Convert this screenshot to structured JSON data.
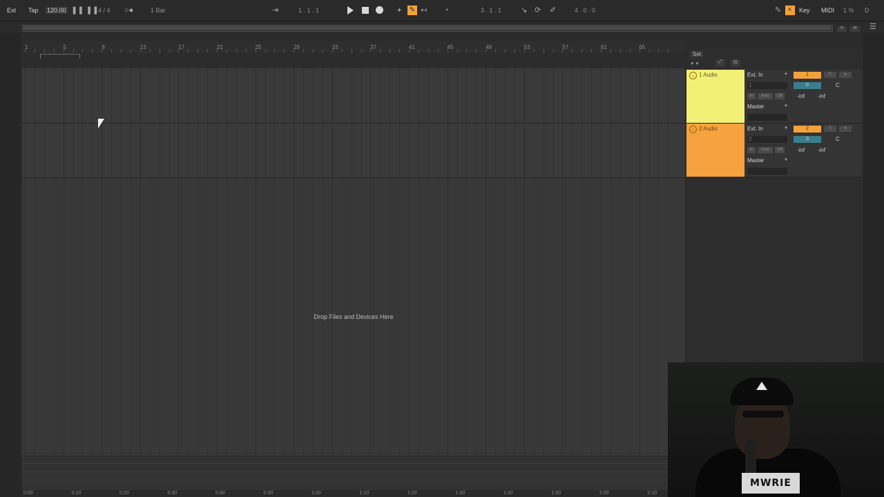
{
  "topbar": {
    "ext_label": "Ext",
    "tap_label": "Tap",
    "tempo": "120.00",
    "signature": "4 / 4",
    "quantize": "1 Bar",
    "position": "1 . 1 . 1",
    "loop_position": "3 . 1 . 1",
    "loop_length": "4 . 0 . 0",
    "key_label": "Key",
    "midi_label": "MIDI",
    "cpu": "1 %",
    "disk": "D",
    "icons": [
      "follow-icon",
      "play-icon",
      "stop-icon",
      "record-icon",
      "add-icon",
      "draw-mode-icon",
      "loop-icon",
      "pencil-icon",
      "key-icon",
      "menu-icon"
    ]
  },
  "ruler": {
    "bars": [
      "1",
      "5",
      "9",
      "13",
      "17",
      "21",
      "25",
      "29",
      "33",
      "37",
      "41",
      "45",
      "49",
      "53",
      "57",
      "61",
      "65"
    ]
  },
  "bottom_ruler": {
    "times": [
      "0:00",
      "0:10",
      "0:20",
      "0:30",
      "0:40",
      "0:50",
      "1:00",
      "1:10",
      "1:20",
      "1:30",
      "1:40",
      "1:50",
      "2:00",
      "2:10"
    ]
  },
  "set_label": "Set",
  "tracks": [
    {
      "name": "1 Audio",
      "color": "#f2f075",
      "input_type": "Ext. In",
      "input_channel": "1",
      "output": "Master",
      "track_number": "1",
      "send": "0",
      "pan": "C",
      "mon_in": "In",
      "mon_auto": "Auto",
      "mon_off": "Off",
      "peak_left": "-inf",
      "peak_right": "-inf"
    },
    {
      "name": "2 Audio",
      "color": "#f6a23f",
      "input_type": "Ext. In",
      "input_channel": "2",
      "output": "Master",
      "track_number": "2",
      "send": "0",
      "pan": "C",
      "mon_in": "In",
      "mon_auto": "Auto",
      "mon_off": "Off",
      "peak_left": "-inf",
      "peak_right": "-inf"
    }
  ],
  "drop_text": "Drop Files and Devices Here",
  "webcam_logo": "MWRIE"
}
